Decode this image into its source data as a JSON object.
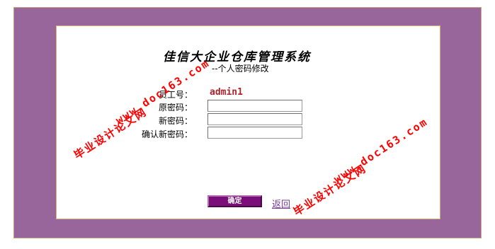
{
  "header": {
    "title": "佳信大企业仓库管理系统",
    "subtitle": "--个人密码修改"
  },
  "form": {
    "employee_id_label": "员工号：",
    "employee_id_value": "admin1",
    "old_password_label": "原密码：",
    "new_password_label": "新密码：",
    "confirm_password_label": "确认新密码：",
    "old_password_value": "",
    "new_password_value": "",
    "confirm_password_value": ""
  },
  "actions": {
    "confirm_label": "确定",
    "back_label": "返回"
  },
  "watermark": {
    "site_text": "毕业设计论文网",
    "url_text": "www.doc163.com"
  },
  "colors": {
    "frame": "#98669a",
    "employee_id": "#b0212a",
    "button": "#7a0f7a",
    "link": "#7a3a9a",
    "watermark": "#ff0000"
  }
}
